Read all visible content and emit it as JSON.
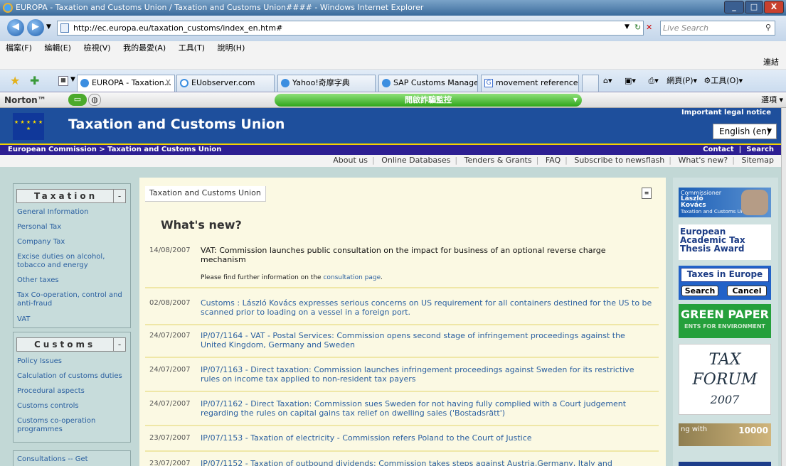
{
  "window": {
    "title": "EUROPA - Taxation and Customs Union / Taxation and Customs Union#### - Windows Internet Explorer",
    "min": "_",
    "max": "□",
    "close": "X"
  },
  "address_bar": {
    "url": "http://ec.europa.eu/taxation_customs/index_en.htm#",
    "search_placeholder": "Live Search"
  },
  "menu": [
    "檔案(F)",
    "編輯(E)",
    "檢視(V)",
    "我的最愛(A)",
    "工具(T)",
    "說明(H)"
  ],
  "links_label": "連結",
  "tabs": [
    {
      "label": "EUROPA - Taxation...",
      "close": "X"
    },
    {
      "label": "EUobserver.com"
    },
    {
      "label": "Yahoo!奇摩字典"
    },
    {
      "label": "SAP Customs Manage..."
    },
    {
      "label": "movement reference ..."
    }
  ],
  "toolbar_right": {
    "page": "網頁(P)",
    "tools": "工具(O)"
  },
  "norton": {
    "logo": "Norton™",
    "main_button": "開啟詐騙監控",
    "options": "選項"
  },
  "site": {
    "title": "Taxation and Customs Union",
    "legal": "Important legal notice",
    "language": "English (en)",
    "breadcrumb": "European Commission > Taxation and Customs Union",
    "contact": "Contact",
    "search": "Search",
    "topnav": [
      "About us",
      "Online Databases",
      "Tenders & Grants",
      "FAQ",
      "Subscribe to newsflash",
      "What's new?",
      "Sitemap"
    ],
    "eu_stars": "★ ★ ★ ★ ★ ★"
  },
  "left": {
    "taxation_header": "Taxation",
    "taxation_items": [
      "General Information",
      "Personal Tax",
      "Company Tax",
      "Excise duties on alcohol, tobacco and energy",
      "Other taxes",
      "Tax Co-operation, control and anti-fraud",
      "VAT"
    ],
    "customs_header": "Customs",
    "customs_items": [
      "Policy Issues",
      "Calculation of customs duties",
      "Procedural aspects",
      "Customs controls",
      "Customs co-operation programmes"
    ],
    "consultations": "Consultations -- Get",
    "collapse": "-"
  },
  "main": {
    "crumb": "Taxation and Customs Union",
    "heading": "What's new?",
    "news": [
      {
        "date": "14/08/2007",
        "title": "VAT: Commission launches public consultation on the impact for business of an optional reverse charge mechanism",
        "note_pre": "Please find further information on the",
        "note_link": "consultation page",
        "note_post": "."
      },
      {
        "date": "02/08/2007",
        "title": "Customs : László Kovács expresses serious concerns on US requirement for all containers destined for the US to be scanned prior to loading on a vessel in a foreign port."
      },
      {
        "date": "24/07/2007",
        "title": "IP/07/1164 - VAT - Postal Services: Commission opens second stage of infringement proceedings against the United Kingdom, Germany and Sweden"
      },
      {
        "date": "24/07/2007",
        "title": "IP/07/1163 - Direct taxation: Commission launches infringement proceedings against Sweden for its restrictive rules on income tax applied to non-resident tax payers"
      },
      {
        "date": "24/07/2007",
        "title": "IP/07/1162 - Direct Taxation: Commission sues Sweden for not having fully complied with a Court judgement regarding the rules on capital gains tax relief on dwelling sales ('Bostadsrätt')"
      },
      {
        "date": "23/07/2007",
        "title": "IP/07/1153 - Taxation of electricity - Commission refers Poland to the Court of Justice"
      },
      {
        "date": "23/07/2007",
        "title": "IP/07/1152 - Taxation of outbound dividends: Commission takes steps against Austria,Germany, Italy and"
      }
    ]
  },
  "right": {
    "commissioner_label": "Commissioner",
    "commissioner_name": "László Kovács",
    "commissioner_sub": "Taxation and Customs Union",
    "award": "European Academic Tax Thesis Award",
    "taxes_in_europe": "Taxes in Europe",
    "search_btn": "Search",
    "cancel_btn": "Cancel",
    "green_paper": "GREEN PAPER",
    "green_paper_sub": "ENTS FOR ENVIRONMENT",
    "forum_1": "TAX",
    "forum_2": "FORUM",
    "forum_3": "2007",
    "banner_text": "ng with",
    "banner_num": "10000"
  }
}
